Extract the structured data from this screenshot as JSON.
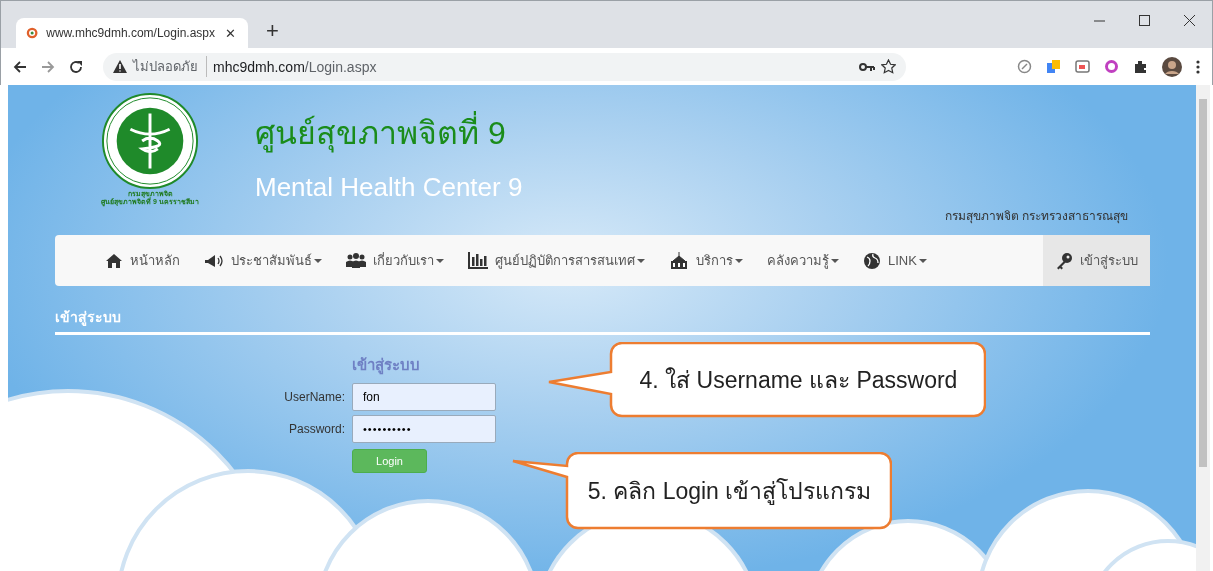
{
  "browser": {
    "tab_title": "www.mhc9dmh.com/Login.aspx",
    "tab_close": "✕",
    "new_tab": "+",
    "security_label": "ไม่ปลอดภัย",
    "url_host": "mhc9dmh.com",
    "url_path": "/Login.aspx"
  },
  "header": {
    "title_th": "ศูนย์สุขภาพจิตที่ 9",
    "title_en": "Mental Health Center 9",
    "logo_caption": [
      "กรมสุขภาพจิต",
      "ศูนย์สุขภาพจิตที่ 9 นครราชสีมา"
    ],
    "department": "กรมสุขภาพจิต กระทรวงสาธารณสุข"
  },
  "nav": {
    "items": [
      {
        "label": "หน้าหลัก",
        "dropdown": false,
        "selected": false
      },
      {
        "label": "ประชาสัมพันธ์",
        "dropdown": true,
        "selected": false
      },
      {
        "label": "เกี่ยวกับเรา",
        "dropdown": true,
        "selected": false
      },
      {
        "label": "ศูนย์ปฏิบัติการสารสนเทศ",
        "dropdown": true,
        "selected": false
      },
      {
        "label": "บริการ",
        "dropdown": true,
        "selected": false
      },
      {
        "label": "คลังความรู้",
        "dropdown": true,
        "selected": false
      },
      {
        "label": "LINK",
        "dropdown": true,
        "selected": false
      },
      {
        "label": "เข้าสู่ระบบ",
        "dropdown": false,
        "selected": true
      }
    ]
  },
  "section_title": "เข้าสู่ระบบ",
  "login": {
    "title": "เข้าสู่ระบบ",
    "fields": [
      {
        "label": "UserName:",
        "value": "fon",
        "kind": "text"
      },
      {
        "label": "Password:",
        "value": "••••••••••",
        "kind": "password"
      }
    ],
    "button": "Login"
  },
  "callouts": [
    {
      "text": "4. ใส่ Username และ Password"
    },
    {
      "text": "5. คลิก Login เข้าสู่โปรแกรม"
    }
  ]
}
